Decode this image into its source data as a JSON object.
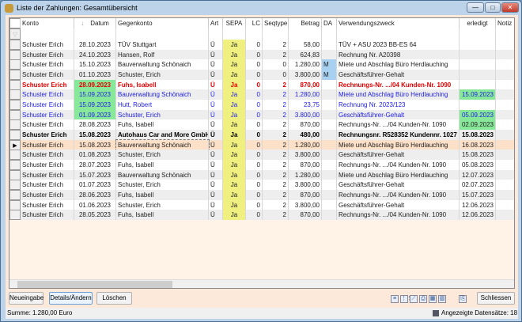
{
  "window": {
    "title": "Liste der Zahlungen: Gesamtübersicht",
    "minimize": "—",
    "maximize": "□",
    "close": "✕"
  },
  "columns": [
    "Konto",
    "Datum",
    "Gegenkonto",
    "Art",
    "SEPA",
    "LC",
    "Seqtype",
    "Betrag",
    "DA",
    "Verwendungszweck",
    "erledigt",
    "Notiz"
  ],
  "sort_icon": "↓",
  "filter_icon": "filter-icon",
  "rows": [
    {
      "style": "normal",
      "cells": [
        "Schuster Erich",
        "28.10.2023",
        "TÜV Stuttgart",
        "Ü",
        "Ja",
        "0",
        "2",
        "58,00",
        "",
        "TÜV + ASU 2023 BB-ES 64",
        "",
        ""
      ]
    },
    {
      "style": "normal",
      "cells": [
        "Schuster Erich",
        "24.10.2023",
        "Hansen, Rolf",
        "Ü",
        "Ja",
        "0",
        "2",
        "624,83",
        "",
        "Rechnung Nr. A20398",
        "",
        ""
      ]
    },
    {
      "style": "normal",
      "cells": [
        "Schuster Erich",
        "15.10.2023",
        "Bauverwaltung Schönaich",
        "Ü",
        "Ja",
        "0",
        "0",
        "1.280,00",
        "M",
        "Miete und Abschlag Büro Herdlauching",
        "",
        ""
      ]
    },
    {
      "style": "normal",
      "cells": [
        "Schuster Erich",
        "01.10.2023",
        "Schuster, Erich",
        "Ü",
        "Ja",
        "0",
        "0",
        "3.800,00",
        "M",
        "Geschäftsführer-Gehalt",
        "",
        ""
      ]
    },
    {
      "style": "red",
      "cells": [
        "Schuster Erich",
        "28.09.2023",
        "Fuhs, Isabell",
        "Ü",
        "Ja",
        "0",
        "2",
        "870,00",
        "",
        "Rechnungs-Nr. .../04 Kunden-Nr. 1090",
        "",
        ""
      ],
      "date_green": true
    },
    {
      "style": "blue",
      "cells": [
        "Schuster Erich",
        "15.09.2023",
        "Bauverwaltung Schönaich",
        "Ü",
        "Ja",
        "0",
        "2",
        "1.280,00",
        "",
        "Miete und Abschlag Büro Herdlauching",
        "15.09.2023",
        ""
      ],
      "date_green": true,
      "done_green": true
    },
    {
      "style": "blue",
      "cells": [
        "Schuster Erich",
        "15.09.2023",
        "Hutt, Robert",
        "Ü",
        "Ja",
        "0",
        "2",
        "23,75",
        "",
        "Rechnung Nr. 2023/123",
        "",
        ""
      ],
      "date_green": true
    },
    {
      "style": "blue",
      "cells": [
        "Schuster Erich",
        "01.09.2023",
        "Schuster, Erich",
        "Ü",
        "Ja",
        "0",
        "2",
        "3.800,00",
        "",
        "Geschäftsführer-Gehalt",
        "05.09.2023",
        ""
      ],
      "date_green": true,
      "done_green": true
    },
    {
      "style": "normal",
      "cells": [
        "Schuster Erich",
        "28.08.2023",
        "Fuhs, Isabell",
        "Ü",
        "Ja",
        "0",
        "2",
        "870,00",
        "",
        "Rechnungs-Nr. .../04 Kunden-Nr. 1090",
        "02.09.2023",
        ""
      ],
      "done_green": true
    },
    {
      "style": "bold",
      "cells": [
        "Schuster Erich",
        "15.08.2023",
        "Autohaus Car and More GmbH",
        "Ü",
        "Ja",
        "0",
        "2",
        "480,00",
        "",
        "Rechnungsnr. R528352 Kundennr. 1027",
        "15.08.2023",
        ""
      ]
    },
    {
      "style": "selected",
      "cells": [
        "Schuster Erich",
        "15.08.2023",
        "Bauverwaltung Schönaich",
        "Ü",
        "Ja",
        "0",
        "2",
        "1.280,00",
        "",
        "Miete und Abschlag Büro Herdlauching",
        "16.08.2023",
        ""
      ]
    },
    {
      "style": "normal",
      "cells": [
        "Schuster Erich",
        "01.08.2023",
        "Schuster, Erich",
        "Ü",
        "Ja",
        "0",
        "2",
        "3.800,00",
        "",
        "Geschäftsführer-Gehalt",
        "15.08.2023",
        ""
      ]
    },
    {
      "style": "normal",
      "cells": [
        "Schuster Erich",
        "28.07.2023",
        "Fuhs, Isabell",
        "Ü",
        "Ja",
        "0",
        "2",
        "870,00",
        "",
        "Rechnungs-Nr. .../04 Kunden-Nr. 1090",
        "05.08.2023",
        ""
      ]
    },
    {
      "style": "normal",
      "cells": [
        "Schuster Erich",
        "15.07.2023",
        "Bauverwaltung Schönaich",
        "Ü",
        "Ja",
        "0",
        "2",
        "1.280,00",
        "",
        "Miete und Abschlag Büro Herdlauching",
        "12.07.2023",
        ""
      ]
    },
    {
      "style": "normal",
      "cells": [
        "Schuster Erich",
        "01.07.2023",
        "Schuster, Erich",
        "Ü",
        "Ja",
        "0",
        "2",
        "3.800,00",
        "",
        "Geschäftsführer-Gehalt",
        "02.07.2023",
        ""
      ]
    },
    {
      "style": "normal",
      "cells": [
        "Schuster Erich",
        "28.06.2023",
        "Fuhs, Isabell",
        "Ü",
        "Ja",
        "0",
        "2",
        "870,00",
        "",
        "Rechnungs-Nr. .../04 Kunden-Nr. 1090",
        "15.07.2023",
        ""
      ]
    },
    {
      "style": "normal",
      "cells": [
        "Schuster Erich",
        "01.06.2023",
        "Schuster, Erich",
        "Ü",
        "Ja",
        "0",
        "2",
        "3.800,00",
        "",
        "Geschäftsführer-Gehalt",
        "12.06.2023",
        ""
      ]
    },
    {
      "style": "normal",
      "cells": [
        "Schuster Erich",
        "28.05.2023",
        "Fuhs, Isabell",
        "Ü",
        "Ja",
        "0",
        "2",
        "870,00",
        "",
        "Rechnungs-Nr. .../04 Kunden-Nr. 1090",
        "12.06.2023",
        ""
      ]
    }
  ],
  "buttons": {
    "new": "Neueingabe",
    "details": "Details/Ändern",
    "delete": "Löschen",
    "close": "Schliessen"
  },
  "toolbar_icons": [
    "list-view-icon",
    "grid-view-icon",
    "filter-clear-icon",
    "print-icon",
    "calculator-icon",
    "columns-icon",
    "export-icon"
  ],
  "status": {
    "sum": "Summe: 1.280,00 Euro",
    "count": "Angezeigte Datensätze: 18"
  },
  "colors": {
    "red": "#e00000",
    "blue": "#2020e0",
    "green": "#88e89a",
    "sepa": "#f0f080",
    "da": "#a8d0f0",
    "selected": "#fde0c8"
  }
}
